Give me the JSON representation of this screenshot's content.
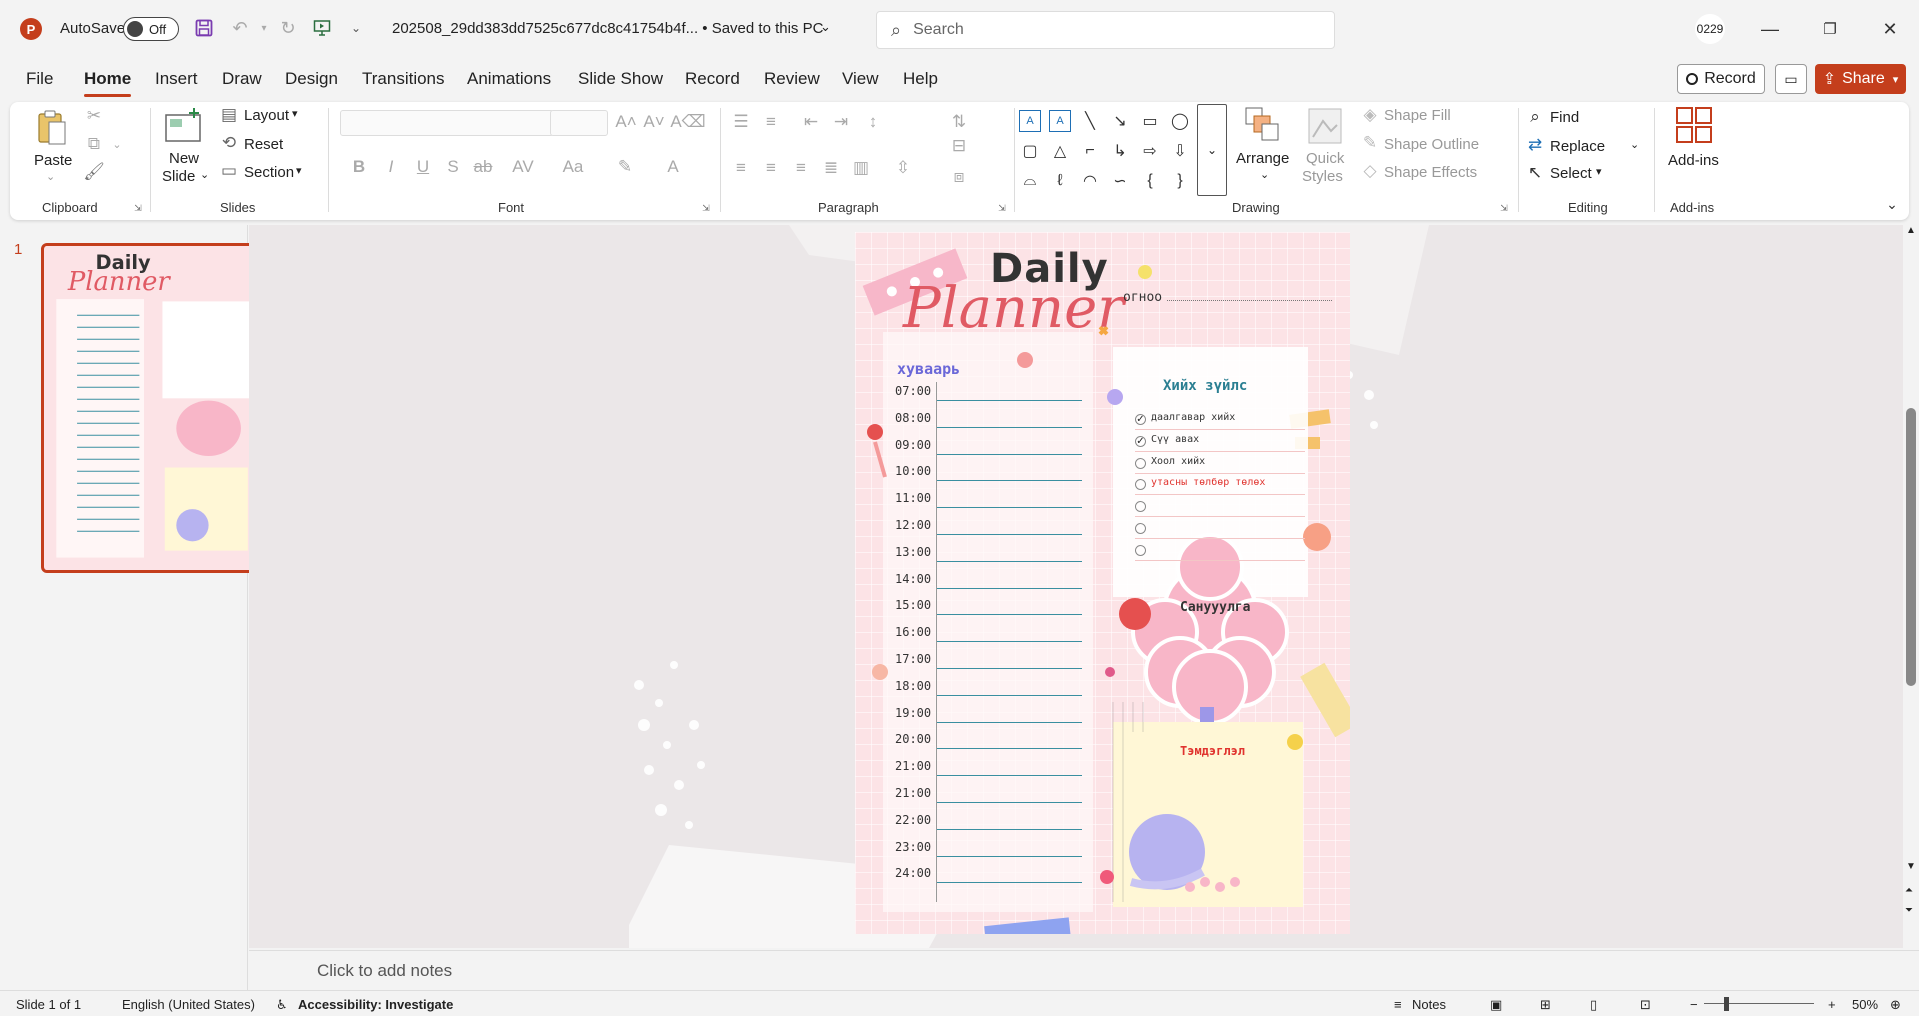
{
  "titlebar": {
    "autosave_label": "AutoSave",
    "autosave_state": "Off",
    "doc_title": "202508_29dd383dd7525c677dc8c41754b4f... • Saved to this PC",
    "search_placeholder": "Search",
    "user_initials": "0229"
  },
  "menu": {
    "tabs": [
      "File",
      "Home",
      "Insert",
      "Draw",
      "Design",
      "Transitions",
      "Animations",
      "Slide Show",
      "Record",
      "Review",
      "View",
      "Help"
    ],
    "active": "Home",
    "record_label": "Record",
    "share_label": "Share"
  },
  "ribbon": {
    "clipboard": {
      "paste": "Paste",
      "label": "Clipboard"
    },
    "slides": {
      "new_slide_1": "New",
      "new_slide_2": "Slide",
      "layout": "Layout",
      "reset": "Reset",
      "section": "Section",
      "label": "Slides"
    },
    "font": {
      "label": "Font"
    },
    "paragraph": {
      "label": "Paragraph"
    },
    "drawing": {
      "arrange": "Arrange",
      "quick_styles_1": "Quick",
      "quick_styles_2": "Styles",
      "shape_fill": "Shape Fill",
      "shape_outline": "Shape Outline",
      "shape_effects": "Shape Effects",
      "label": "Drawing"
    },
    "editing": {
      "find": "Find",
      "replace": "Replace",
      "select": "Select",
      "label": "Editing"
    },
    "addins": {
      "addins": "Add-ins",
      "label": "Add-ins"
    }
  },
  "thumbnails": {
    "slide_number": "1"
  },
  "slide": {
    "title_daily": "Daily",
    "title_planner": "Planner",
    "date_label": "огноо",
    "schedule_heading": "хуваарь",
    "times": [
      "07:00",
      "08:00",
      "09:00",
      "10:00",
      "11:00",
      "12:00",
      "13:00",
      "14:00",
      "15:00",
      "16:00",
      "17:00",
      "18:00",
      "19:00",
      "20:00",
      "21:00",
      "21:00",
      "22:00",
      "23:00",
      "24:00"
    ],
    "todo_heading": "Хийх зүйлс",
    "todos": [
      {
        "text": "даалгавар хийх",
        "checked": true,
        "color": "#333333"
      },
      {
        "text": "Сүү авах",
        "checked": true,
        "color": "#333333"
      },
      {
        "text": "Хоол хийх",
        "checked": false,
        "color": "#333333"
      },
      {
        "text": "утасны төлбөр төлөх",
        "checked": false,
        "color": "#e0342f"
      },
      {
        "text": "",
        "checked": false,
        "color": "#333333"
      },
      {
        "text": "",
        "checked": false,
        "color": "#333333"
      },
      {
        "text": "",
        "checked": false,
        "color": "#333333"
      }
    ],
    "reminder_heading": "Санууулга",
    "notes_heading": "Тэмдэглэл"
  },
  "notes_placeholder": "Click to add notes",
  "status": {
    "slide_count": "Slide 1 of 1",
    "language": "English (United States)",
    "accessibility": "Accessibility: Investigate",
    "notes": "Notes",
    "zoom": "50%"
  },
  "colors": {
    "accent": "#c43e1c",
    "slide_bg": "#fce3e6",
    "teal_line": "#3a8fa0"
  }
}
